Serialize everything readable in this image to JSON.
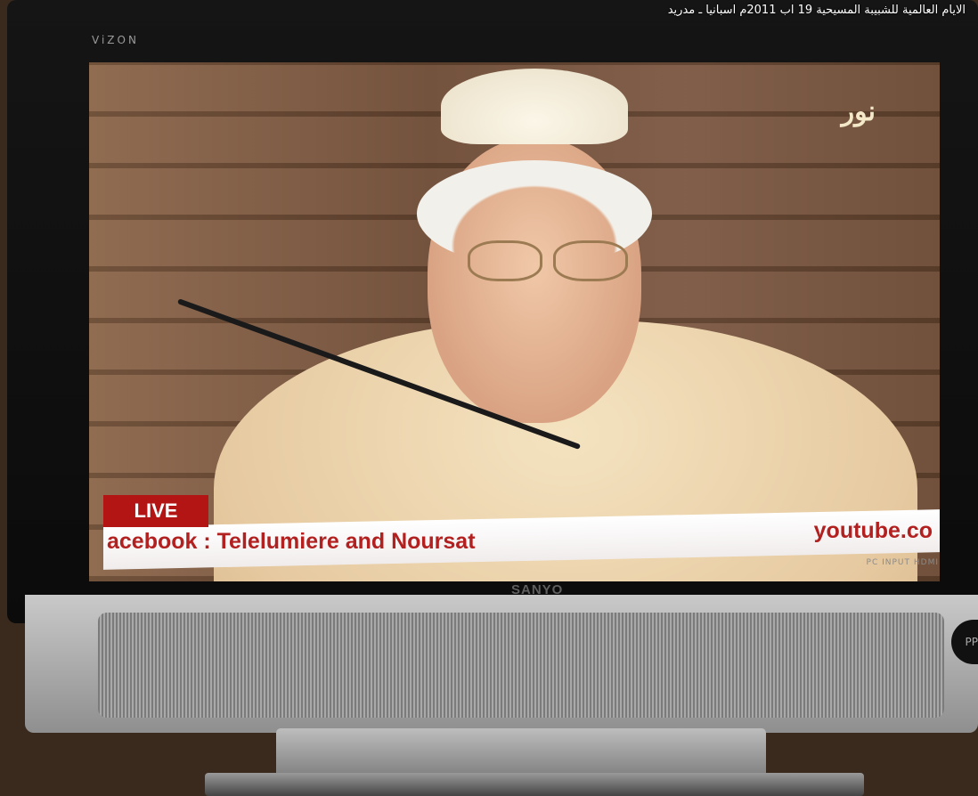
{
  "caption": "الايام العالمية للشبيبة المسيحية 19 اب 2011م اسبانيا ـ مدريد",
  "tv": {
    "bezel_brand": "ViZON",
    "maker": "SANYO",
    "ports_label": "PC INPUT   HDMI"
  },
  "broadcast": {
    "channel_logo": "نور",
    "live_label": "LIVE",
    "ticker_left": "acebook : Telelumiere and Noursat",
    "ticker_right": "youtube.co"
  },
  "colors": {
    "ticker_text": "#b22020",
    "live_bg": "#b31515"
  }
}
